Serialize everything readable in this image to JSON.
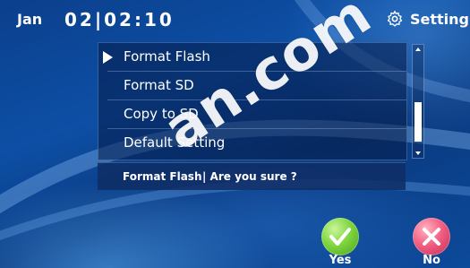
{
  "topbar": {
    "month": "Jan",
    "day_time": "02|02:10",
    "setting_label": "Setting"
  },
  "menu": {
    "items": [
      {
        "label": "Format Flash",
        "selected": true
      },
      {
        "label": "Format SD",
        "selected": false
      },
      {
        "label": "Copy to SD",
        "selected": false
      },
      {
        "label": "Default Setting",
        "selected": false
      }
    ]
  },
  "confirm": {
    "item": "Format Flash",
    "question": "| Are you sure ?"
  },
  "buttons": {
    "yes_label": "Yes",
    "no_label": "No"
  },
  "watermark": "an.com",
  "colors": {
    "background": "#0a3f8a",
    "yes": "#7fd63e",
    "no": "#f25f82"
  }
}
